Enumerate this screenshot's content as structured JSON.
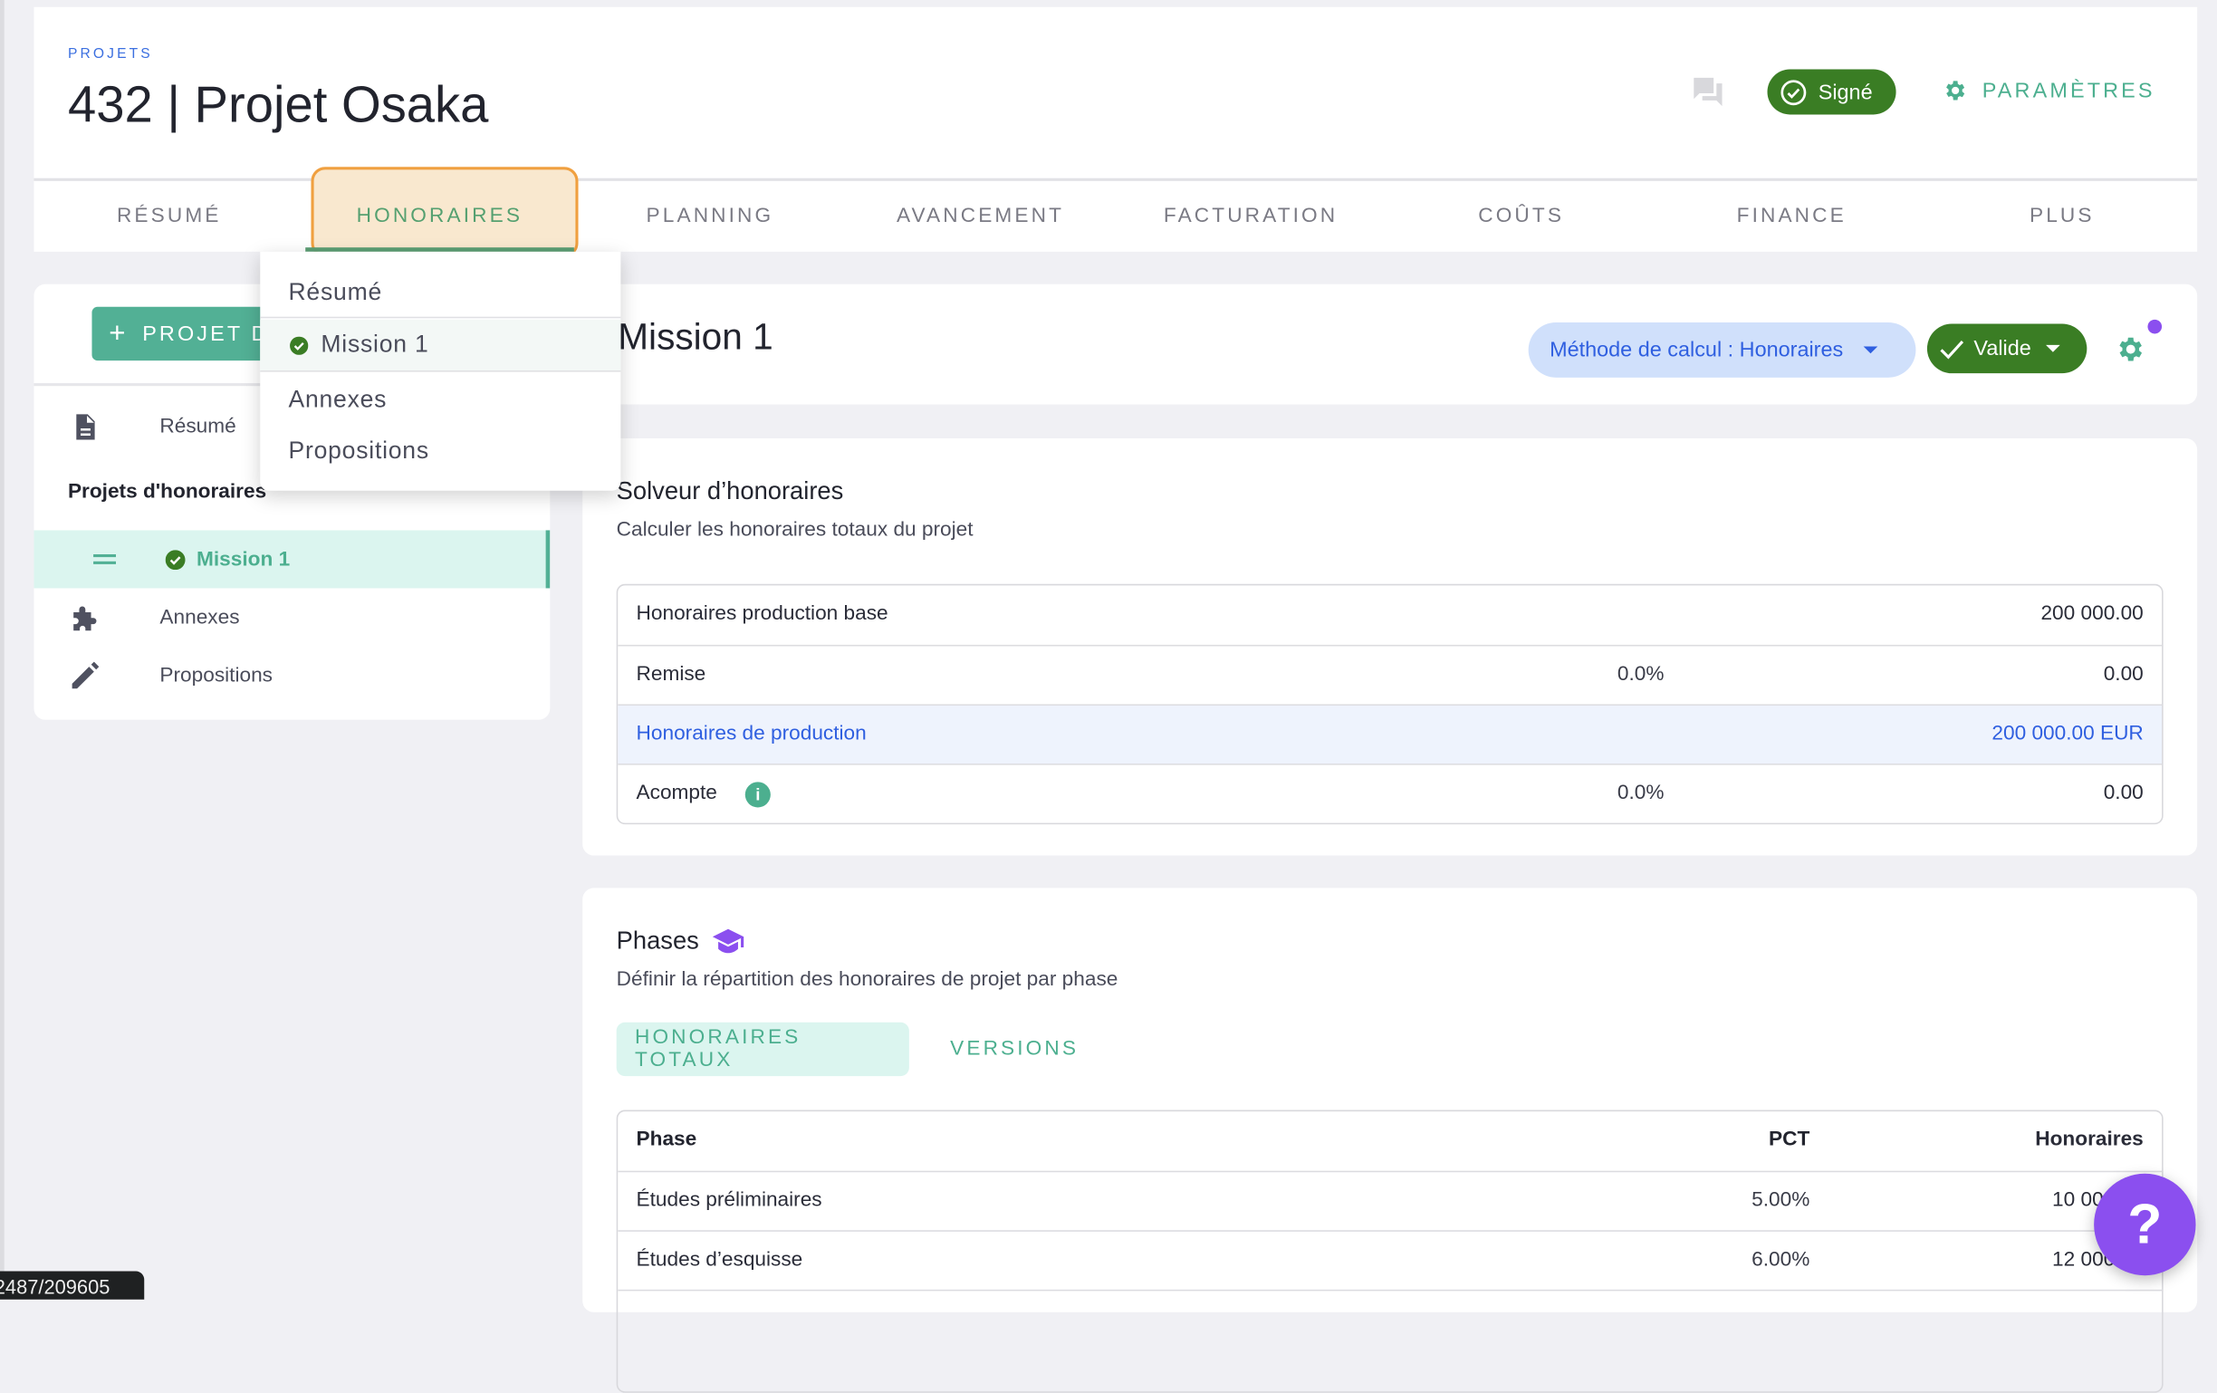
{
  "header": {
    "breadcrumb": "PROJETS",
    "title": "432 | Projet Osaka",
    "status_badge": "Signé",
    "settings_label": "PARAMÈTRES",
    "tabs": [
      {
        "label": "RÉSUMÉ"
      },
      {
        "label": "HONORAIRES",
        "active": true
      },
      {
        "label": "PLANNING"
      },
      {
        "label": "AVANCEMENT"
      },
      {
        "label": "FACTURATION"
      },
      {
        "label": "COÛTS"
      },
      {
        "label": "FINANCE"
      },
      {
        "label": "PLUS"
      }
    ]
  },
  "dropdown": {
    "items": [
      {
        "label": "Résumé"
      },
      {
        "label": "Mission 1",
        "selected": true
      },
      {
        "label": "Annexes"
      },
      {
        "label": "Propositions"
      }
    ]
  },
  "sidebar": {
    "add_button": "PROJET D",
    "resume": "Résumé",
    "section_title": "Projets d'honoraires",
    "mission": "Mission 1",
    "annexes": "Annexes",
    "propositions": "Propositions"
  },
  "mission": {
    "title": "Mission 1",
    "method_select": "Méthode de calcul : Honoraires",
    "status_select": "Valide"
  },
  "solver": {
    "title": "Solveur d’honoraires",
    "subtitle": "Calculer les honoraires totaux du projet",
    "rows": [
      {
        "label": "Honoraires production base",
        "pct": "",
        "value": "200 000.00"
      },
      {
        "label": "Remise",
        "pct": "0.0%",
        "value": "0.00"
      },
      {
        "label": "Honoraires de production",
        "pct": "",
        "value": "200 000.00 EUR"
      },
      {
        "label": "Acompte",
        "pct": "0.0%",
        "value": "0.00"
      }
    ]
  },
  "phases": {
    "title": "Phases",
    "subtitle": "Définir la répartition des honoraires de projet par phase",
    "tabs": [
      "HONORAIRES TOTAUX",
      "VERSIONS"
    ],
    "columns": [
      "Phase",
      "PCT",
      "Honoraires"
    ],
    "rows": [
      {
        "phase": "Études préliminaires",
        "pct": "5.00%",
        "fee": "10 000.00"
      },
      {
        "phase": "Études d’esquisse",
        "pct": "6.00%",
        "fee": "12 000.00"
      }
    ]
  },
  "help_button": "?",
  "tooltip": "2487/209605",
  "colors": {
    "accent": "#52b095",
    "status_green": "#3a7d24",
    "link_blue": "#2f5fe0",
    "purple": "#8b4fef",
    "highlight_orange": "#f0a040"
  }
}
